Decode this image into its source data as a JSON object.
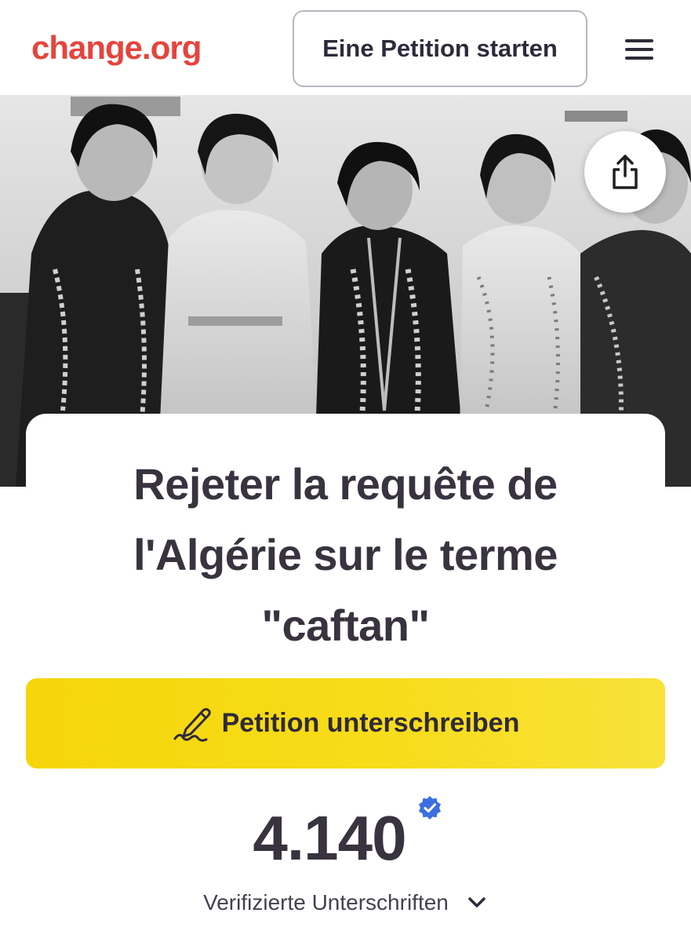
{
  "header": {
    "logo_text": "change.org",
    "start_petition_label": "Eine Petition starten",
    "menu_icon": "hamburger-menu-icon"
  },
  "hero": {
    "image_description_icon": "black-and-white-photo",
    "share_icon": "share-icon"
  },
  "petition": {
    "title_line1": "Rejeter la requête de",
    "title_line2": "l'Algérie sur le terme",
    "title_line3": "\"caftan\"",
    "sign_button_label": "Petition unterschreiben",
    "sign_icon": "pen-signature-icon",
    "signature_count": "4.140",
    "verified_label": "Verifizierte Unterschriften",
    "verified_icon": "verified-badge-icon",
    "expand_icon": "chevron-down-icon"
  },
  "colors": {
    "brand": "#e5443d",
    "sign_button": "#f7dc19",
    "verified_badge": "#3c6fe0",
    "text_dark": "#38333f"
  }
}
